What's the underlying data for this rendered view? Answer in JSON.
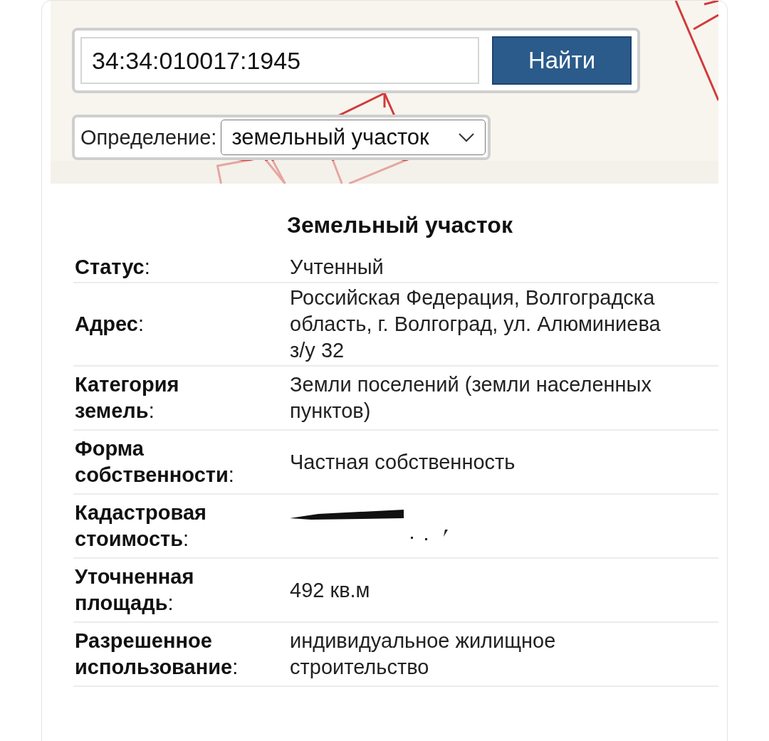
{
  "search": {
    "value": "34:34:010017:1945",
    "button": "Найти"
  },
  "definition": {
    "label": "Определение:",
    "value": "земельный участок"
  },
  "card": {
    "title": "Земельный участок",
    "rows": [
      {
        "kind": "text",
        "label": "**Статус**:",
        "lines": [
          "Учтенный"
        ]
      },
      {
        "kind": "text",
        "label": "**Адрес**:",
        "lines": [
          "Российская Федерация, Волгоградска",
          "область, г. Волгоград, ул. Алюминиева",
          "з/у 32"
        ]
      },
      {
        "kind": "text",
        "label": "**Категория земель**:",
        "lines": [
          "Земли поселений (земли населенных",
          "пунктов)"
        ]
      },
      {
        "kind": "text",
        "label": "**Форма собственности**:",
        "lines": [
          "Частная собственность"
        ]
      },
      {
        "kind": "redacted",
        "label": "**Кадастровая стоимость**:"
      },
      {
        "kind": "text",
        "label": "**Уточненная площадь**:",
        "lines": [
          "492 кв.м"
        ]
      },
      {
        "kind": "text",
        "label": "**Разрешенное использование**:",
        "lines": [
          "индивидуальное жилищное",
          "строительство"
        ]
      }
    ]
  }
}
